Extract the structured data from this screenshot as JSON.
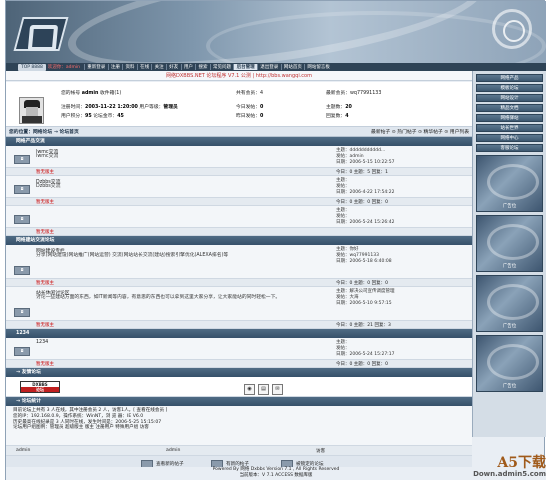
{
  "nav": {
    "top": "TOP 8888",
    "welcome": "欢迎你：admin",
    "items": [
      "重新登录",
      "注册",
      "资料",
      "在线",
      "关注",
      "好友",
      "用户",
      "搜索",
      "常见问题",
      "后台管理",
      "退出登录",
      "网站首页",
      "网站留言板"
    ]
  },
  "topline": "网络DXBBS.NET 论坛程序 V7.1 公测 | http://bbs.wangqi.com",
  "user": {
    "account_label": "您的帐号",
    "account": "admin",
    "msgbox": "收件箱(1)",
    "reg_label": "注册时间：",
    "reg": "2003-11-22 1:20:00",
    "level_label": "用户等级：",
    "level": "管理员",
    "group_label": "用户积分：",
    "group": "95",
    "forum_level_label": "论坛金币：",
    "forum_level": "45",
    "members_label": "共有会员：",
    "members": "4",
    "newest_label": "最新会员：",
    "newest": "wq77991133",
    "today_label": "今日发帖：",
    "today": "0",
    "topics_label": "主题数：",
    "topics": "20",
    "yesterday_label": "昨日发帖：",
    "yesterday": "0",
    "posts_label": "回复数：",
    "posts": "4"
  },
  "breadcrumb": {
    "label": "您的位置：",
    "path": "网络论坛 → 论坛首页",
    "links": "最新帖子 ⊙ 热门帖子 ⊙ 精华帖子 ⊙ 用户列表"
  },
  "sections": [
    {
      "title": "网络产品交流",
      "forums": [
        {
          "name": "lwmc交流",
          "desc": "lwmc交流",
          "last": [
            "主题：ddddddddddd...",
            "发帖：admin",
            "日期：2006-5-15 10:22:57"
          ],
          "mod": "暂无版主",
          "count": "今日：0 主题：5 回复：1"
        },
        {
          "name": "Dzbbs交流",
          "desc": "Dzbbs交流",
          "last": [
            "主题：",
            "发帖：",
            "日期：2006-4-22 17:54:22"
          ],
          "mod": "暂无版主",
          "count": "今日：0 主题：0 回复：0"
        },
        {
          "name": "",
          "desc": "",
          "last": [
            "主题：",
            "发帖：",
            "日期：2006-5-24 15:26:42"
          ],
          "mod": "暂无版主",
          "count": ""
        }
      ]
    },
    {
      "title": "网络建站交流论坛",
      "forums": [
        {
          "name": "网站建设专栏",
          "desc": "分享(网站建设)网站推广(网站运营) 交流(网站站长交流(建站)搜索引擎优化(ALEXA排名)等",
          "last": [
            "主题：你好",
            "发帖：wq77991133",
            "日期：2006-5-18 6:40:08"
          ],
          "mod": "暂无版主",
          "count": "今日：0 主题：0 回复：0"
        },
        {
          "name": "站长休闲讨论区",
          "desc": "讨论一些建站方面的东西，如IT新闻等内容，有意思的东西也可以拿到这里大家分享，让大家能站的同时轻松一下。",
          "last": [
            "主题：解决公司宣传调度管理",
            "发帖：大海",
            "日期：2006-5-10 9:57:15"
          ],
          "mod": "暂无版主",
          "count": "今日：0 主题：21 回复：3"
        }
      ]
    },
    {
      "title": "1234",
      "forums": [
        {
          "name": "1234",
          "desc": "",
          "last": [
            "主题：",
            "发帖：",
            "日期：2006-5-24 15:27:17"
          ],
          "mod": "暂无版主",
          "count": "今日：0 主题：0 回复：0"
        }
      ]
    }
  ],
  "links_title": "→ 友情论坛",
  "dx_logo": [
    "DXBBS",
    "论坛"
  ],
  "stats_title": "→ 论坛统计",
  "stats_lines": [
    "目前论坛上共有 3 人在线，其中注册会员 2 人，访客1人。[ 查看在线会员 ]",
    "您的IP：192.168.0.9，操作系统：WinNT，浏 览 器：IE V6.0",
    "历史最高在线纪录是 3 人同时在线，发生时间是：2006-5-25 15:15:07",
    "论坛用户组图例：管理员 超级版主 版主 注册用户 特殊用户组 访客"
  ],
  "legend": [
    "admin",
    "admin",
    "访客"
  ],
  "tools": [
    "查看新的帖子",
    "有新的帖子",
    "被锁定的论坛"
  ],
  "sidebar": [
    "网络产品",
    "模板论坛",
    "网站设计",
    "精品文档",
    "网络驿站",
    "站长世界",
    "网络中心",
    "客服论坛"
  ],
  "ad_label": "广告位",
  "footer": [
    "Powered By 网络 Dxbbs Version 7.1 , All Rights Reserved",
    "当前版本：V 7.1 ACCESS 数据库版"
  ],
  "watermark": {
    "a5": "A5下载",
    "domain": "Down.admin5.com"
  }
}
